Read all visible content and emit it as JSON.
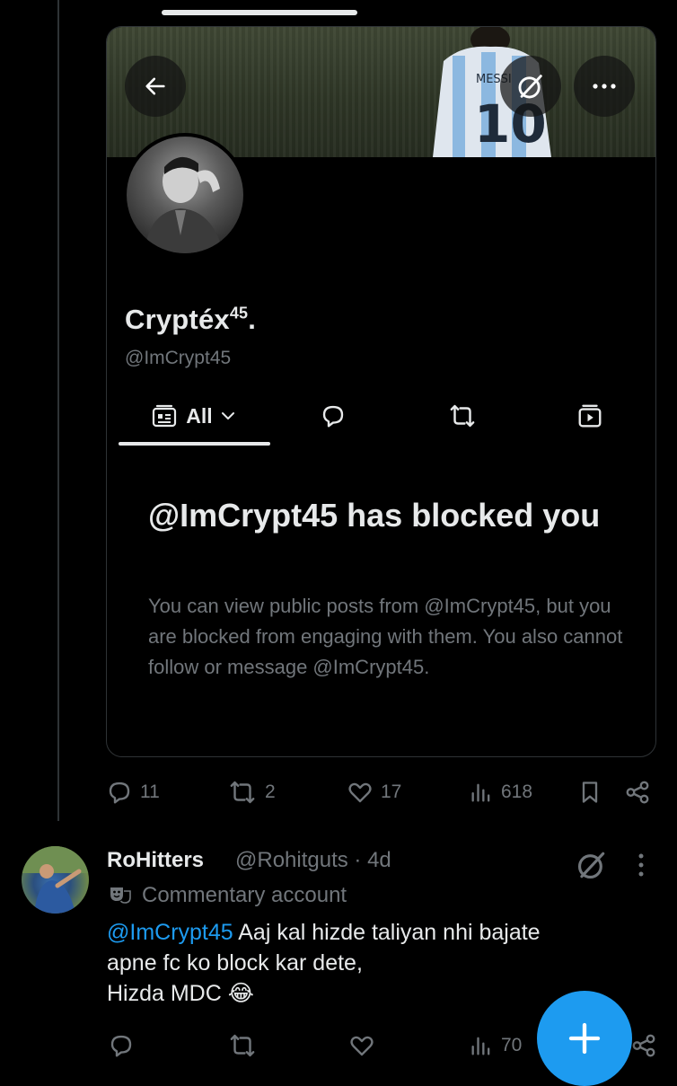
{
  "card": {
    "display_name": "Cryptéx",
    "display_name_sup": "45",
    "display_name_suffix": ".",
    "handle": "@ImCrypt45",
    "jersey_text": "10",
    "jersey_name": "MESSI",
    "tabs": [
      {
        "label": "All",
        "icon": "feed-icon"
      },
      {
        "label": "",
        "icon": "reply-bubble-icon"
      },
      {
        "label": "",
        "icon": "repost-icon"
      },
      {
        "label": "",
        "icon": "media-icon"
      }
    ],
    "blocked_title": "@ImCrypt45 has blocked you",
    "blocked_desc": "You can view public posts from @ImCrypt45, but you are blocked from engaging with them. You also cannot follow or message @ImCrypt45."
  },
  "post_actions": {
    "replies": "11",
    "reposts": "2",
    "likes": "17",
    "views": "618"
  },
  "reply": {
    "name": "RoHitters",
    "handle": "@Rohitguts · 4d",
    "label": "Commentary account",
    "mention": "@ImCrypt45",
    "text_line1": " Aaj kal hizde taliyan nhi bajate",
    "text_line2": "apne fc ko block kar dete,",
    "text_line3": "Hizda MDC 😂",
    "views": "70"
  },
  "colors": {
    "accent": "#1d9bf0",
    "muted": "#71767b",
    "text": "#e7e9ea",
    "border": "#2f3336"
  }
}
